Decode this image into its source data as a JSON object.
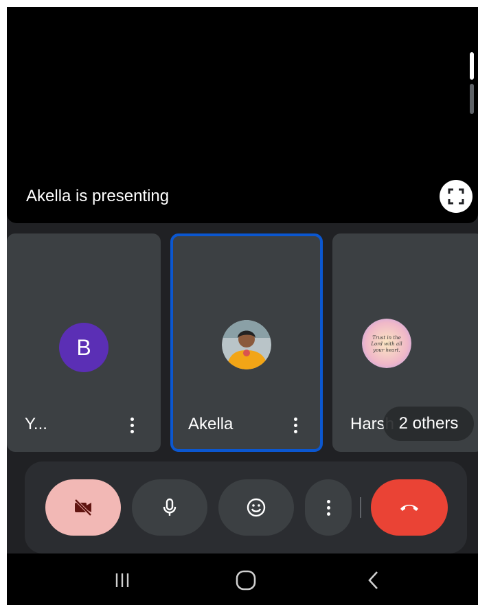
{
  "presentation": {
    "label": "Akella is presenting",
    "fullscreen_icon": "fullscreen-icon"
  },
  "tiles": [
    {
      "name": "Y...",
      "avatar_letter": "B",
      "avatar_color": "#5b2fb5",
      "active": false
    },
    {
      "name": "Akella",
      "avatar": "photo",
      "active": true
    },
    {
      "name": "Harsh",
      "avatar": "quote-image",
      "active": false
    }
  ],
  "others_chip": "2 others",
  "avatar_quote_text": "Trust in the Lord with all your heart.",
  "controls": {
    "camera_icon": "camera-off-icon",
    "mic_icon": "mic-icon",
    "reaction_icon": "emoji-icon",
    "more_icon": "more-vert-icon",
    "end_call_icon": "end-call-icon"
  },
  "colors": {
    "active_border": "#0b57d0",
    "camera_off_bg": "#f2b8b5",
    "end_call_bg": "#ea4335",
    "tile_bg": "#3c4043"
  },
  "navbar": {
    "recents_icon": "recents-icon",
    "home_icon": "home-icon",
    "back_icon": "back-icon"
  }
}
